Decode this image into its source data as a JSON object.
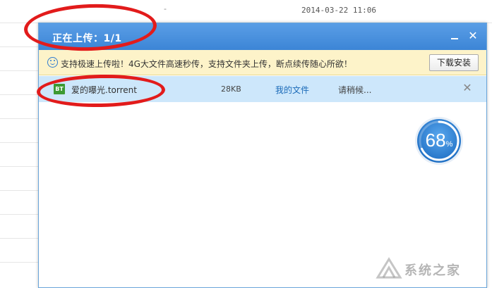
{
  "background": {
    "dash": "-",
    "timestamp": "2014-03-22 11:06"
  },
  "upload_window": {
    "title": "正在上传：1/1",
    "minimize_icon": "minimize-icon",
    "close_icon": "close-icon",
    "notice": {
      "text": "支持极速上传啦！4G大文件高速秒传，支持文件夹上传，断点续传随心所欲！",
      "install_label": "下载安装"
    },
    "files": [
      {
        "type_badge": "BT",
        "name": "爱的曝光.torrent",
        "size": "28KB",
        "directory": "我的文件",
        "status": "请稍候..."
      }
    ],
    "progress": {
      "value": "68",
      "unit": "%",
      "fraction": 0.68
    }
  },
  "watermark": {
    "text": "系统之家"
  },
  "colors": {
    "title_bar": "#3c85d6",
    "notice_bg": "#fdf3c9",
    "row_bg": "#cde7fb",
    "annotation": "#e21b1b",
    "progress_ring": "#2f86d8"
  }
}
